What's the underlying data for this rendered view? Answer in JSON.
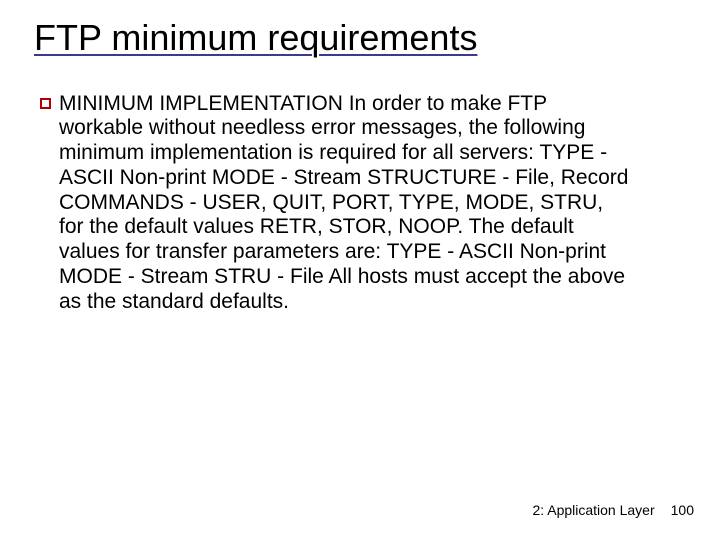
{
  "title": "FTP minimum requirements",
  "bullet_text": "MINIMUM IMPLEMENTATION In order to make FTP workable without needless error messages, the following minimum implementation is required for all servers: TYPE - ASCII Non-print MODE - Stream STRUCTURE - File, Record COMMANDS - USER, QUIT, PORT, TYPE, MODE, STRU, for the default values RETR, STOR, NOOP. The default values for transfer parameters are: TYPE - ASCII Non-print MODE - Stream STRU - File All hosts must accept the above as the standard defaults.",
  "footer": {
    "chapter": "2: Application Layer",
    "page": "100"
  }
}
